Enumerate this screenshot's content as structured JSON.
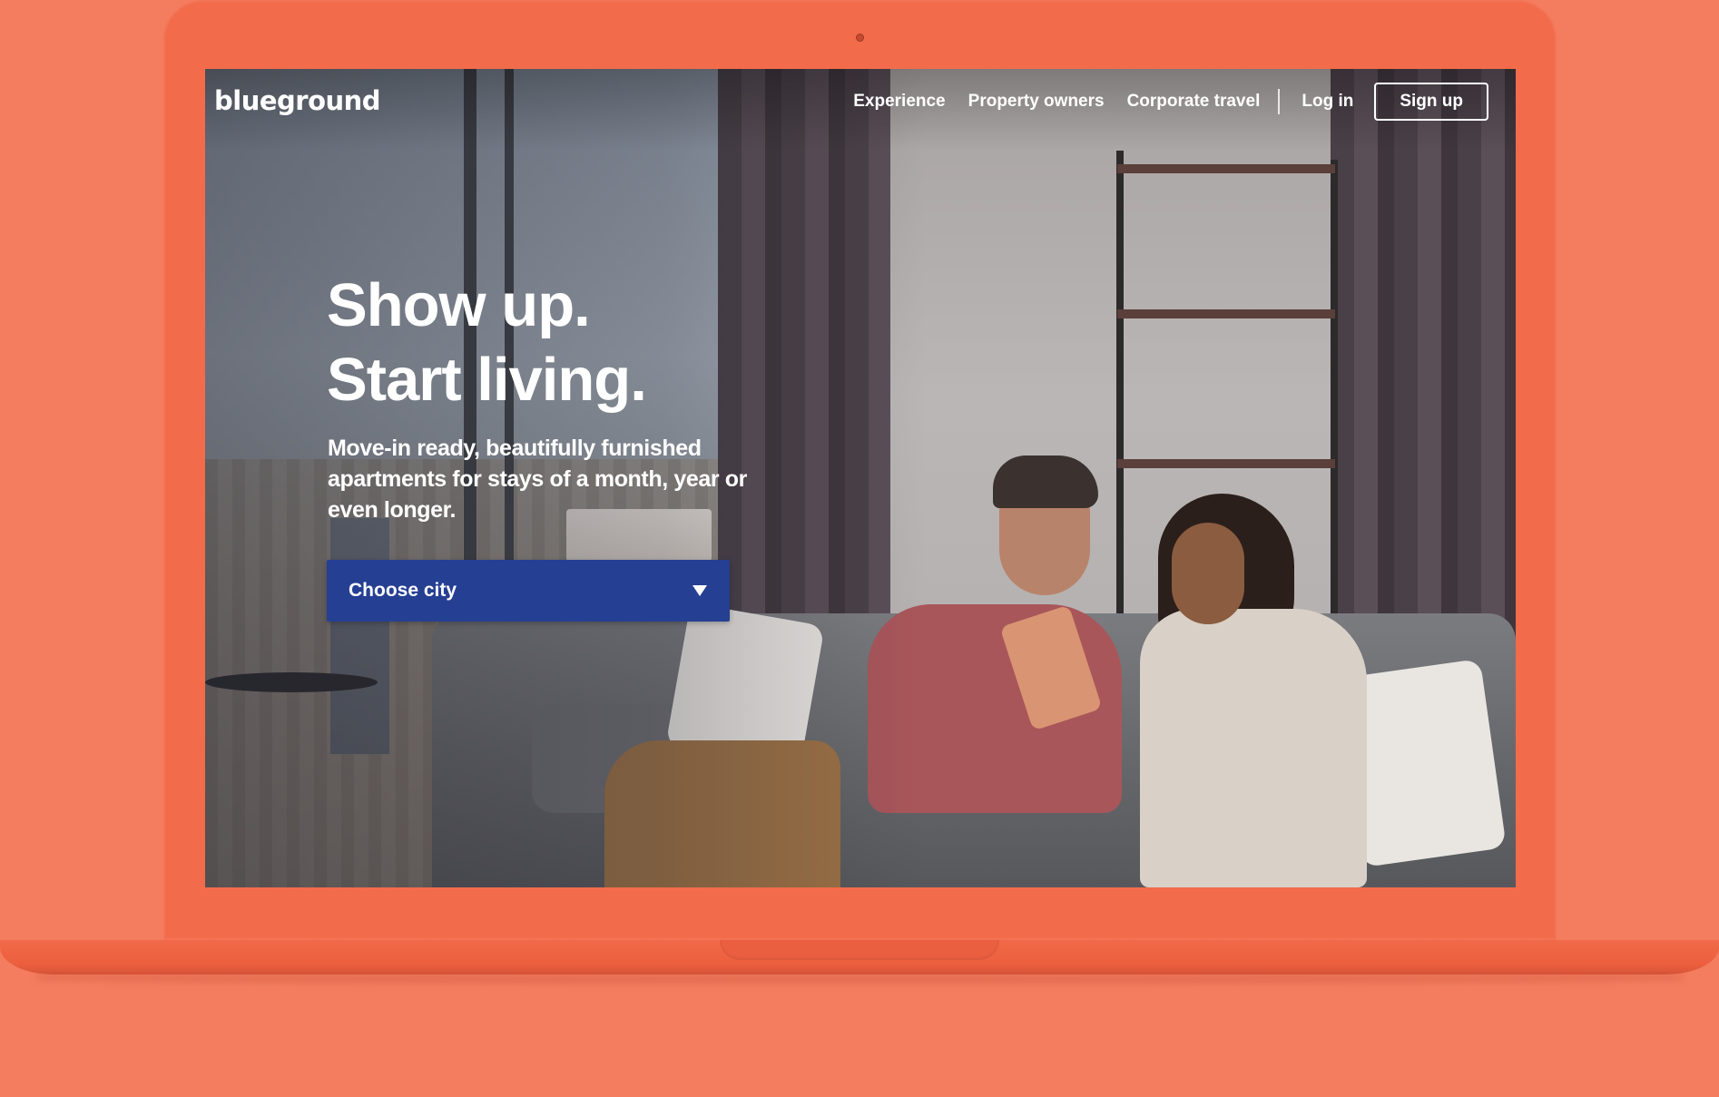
{
  "brand": {
    "logo_text": "blueground",
    "accent_color": "#253f93",
    "device_color": "#f26b4b"
  },
  "nav": {
    "links": [
      "Experience",
      "Property owners",
      "Corporate travel"
    ],
    "login": "Log in",
    "signup": "Sign up"
  },
  "hero": {
    "title_line1": "Show up.",
    "title_line2": "Start living.",
    "subtitle": "Move-in ready, beautifully furnished apartments for stays of a month, year or even longer."
  },
  "city_select": {
    "label": "Choose city",
    "icon": "chevron-down-icon"
  }
}
